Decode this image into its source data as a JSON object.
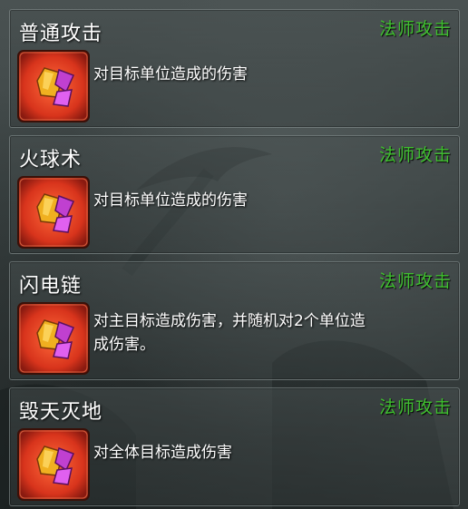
{
  "skills": [
    {
      "name": "普通攻击",
      "type": "法师攻击",
      "icon": "magic-crystal-icon",
      "description": "对目标单位造成的伤害"
    },
    {
      "name": "火球术",
      "type": "法师攻击",
      "icon": "magic-crystal-icon",
      "description": "对目标单位造成的伤害"
    },
    {
      "name": "闪电链",
      "type": "法师攻击",
      "icon": "magic-crystal-icon",
      "description": "对主目标造成伤害，并随机对2个单位造成伤害。"
    },
    {
      "name": "毁天灭地",
      "type": "法师攻击",
      "icon": "magic-crystal-icon",
      "description": "对全体目标造成伤害"
    }
  ],
  "colors": {
    "type_label": "#3fbf2f",
    "icon_border": "#c0281c",
    "icon_background": "#d8341c"
  }
}
